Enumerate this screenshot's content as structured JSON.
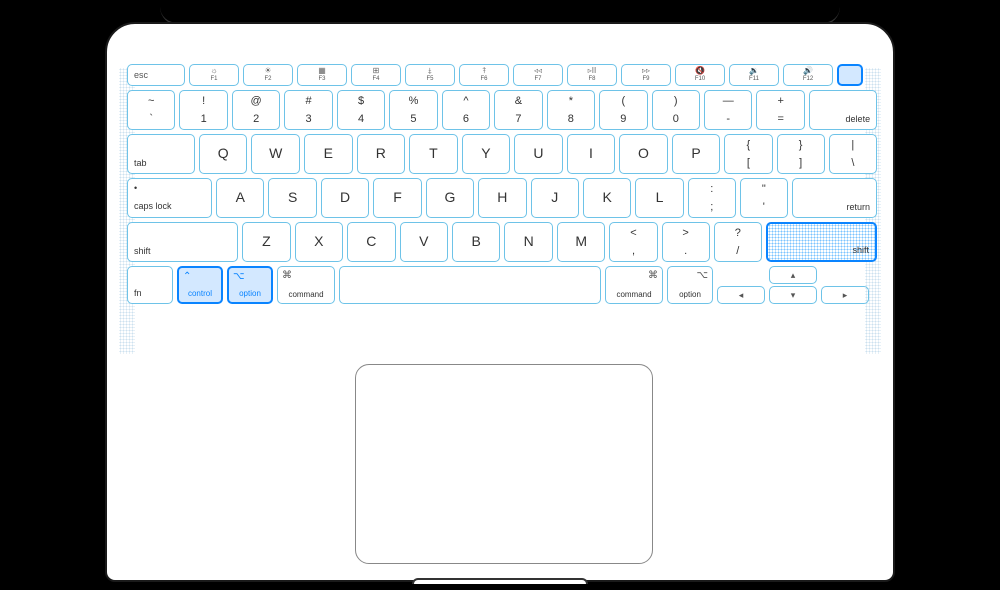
{
  "fnrow": {
    "esc": "esc",
    "keys": [
      {
        "icon": "☼",
        "label": "F1"
      },
      {
        "icon": "☀",
        "label": "F2"
      },
      {
        "icon": "▦",
        "label": "F3"
      },
      {
        "icon": "⊞",
        "label": "F4"
      },
      {
        "icon": "⤈",
        "label": "F5"
      },
      {
        "icon": "⤉",
        "label": "F6"
      },
      {
        "icon": "◃◃",
        "label": "F7"
      },
      {
        "icon": "▹II",
        "label": "F8"
      },
      {
        "icon": "▹▹",
        "label": "F9"
      },
      {
        "icon": "🔇",
        "label": "F10"
      },
      {
        "icon": "🔉",
        "label": "F11"
      },
      {
        "icon": "🔊",
        "label": "F12"
      }
    ]
  },
  "numrow": [
    {
      "top": "~",
      "bot": "`"
    },
    {
      "top": "!",
      "bot": "1"
    },
    {
      "top": "@",
      "bot": "2"
    },
    {
      "top": "#",
      "bot": "3"
    },
    {
      "top": "$",
      "bot": "4"
    },
    {
      "top": "%",
      "bot": "5"
    },
    {
      "top": "^",
      "bot": "6"
    },
    {
      "top": "&",
      "bot": "7"
    },
    {
      "top": "*",
      "bot": "8"
    },
    {
      "top": "(",
      "bot": "9"
    },
    {
      "top": ")",
      "bot": "0"
    },
    {
      "top": "—",
      "bot": "-"
    },
    {
      "top": "+",
      "bot": "="
    }
  ],
  "delete": "delete",
  "tab": "tab",
  "qrow": [
    "Q",
    "W",
    "E",
    "R",
    "T",
    "Y",
    "U",
    "I",
    "O",
    "P"
  ],
  "qrow_end": [
    {
      "top": "{",
      "bot": "["
    },
    {
      "top": "}",
      "bot": "]"
    },
    {
      "top": "|",
      "bot": "\\"
    }
  ],
  "caps_icon": "•",
  "caps": "caps lock",
  "arow": [
    "A",
    "S",
    "D",
    "F",
    "G",
    "H",
    "J",
    "K",
    "L"
  ],
  "arow_end": [
    {
      "top": ":",
      "bot": ";"
    },
    {
      "top": "\"",
      "bot": "'"
    }
  ],
  "return": "return",
  "shift": "shift",
  "zrow": [
    "Z",
    "X",
    "C",
    "V",
    "B",
    "N",
    "M"
  ],
  "zrow_end": [
    {
      "top": "<",
      "bot": ","
    },
    {
      "top": ">",
      "bot": "."
    },
    {
      "top": "?",
      "bot": "/"
    }
  ],
  "mods": {
    "fn": "fn",
    "control": {
      "icon": "⌃",
      "label": "control"
    },
    "option": {
      "icon": "⌥",
      "label": "option"
    },
    "command": {
      "icon": "⌘",
      "label": "command"
    }
  },
  "arrows": {
    "up": "▴",
    "down": "▾",
    "left": "◂",
    "right": "▸"
  },
  "highlighted_keys": [
    "power-button",
    "right-shift",
    "left-control",
    "left-option"
  ]
}
